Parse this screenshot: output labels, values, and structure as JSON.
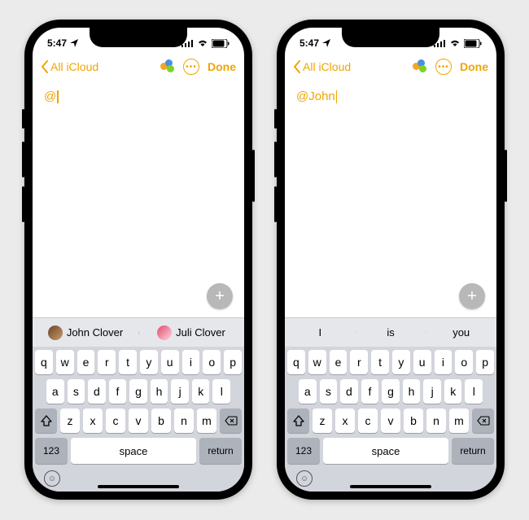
{
  "status": {
    "time": "5:47"
  },
  "nav": {
    "back": "All iCloud",
    "done": "Done"
  },
  "phones": [
    {
      "noteText": "@",
      "suggestions": [
        {
          "label": "John Clover",
          "avatar": "linear-gradient(135deg,#6b4226,#c69c6d)"
        },
        {
          "label": "Juli Clover",
          "avatar": "linear-gradient(135deg,#e3486b,#ffd6e0)"
        }
      ],
      "suggestionType": "contact"
    },
    {
      "noteText": "@John",
      "suggestions": [
        {
          "label": "I"
        },
        {
          "label": "is"
        },
        {
          "label": "you"
        }
      ],
      "suggestionType": "word"
    }
  ],
  "keyboard": {
    "rows": [
      [
        "q",
        "w",
        "e",
        "r",
        "t",
        "y",
        "u",
        "i",
        "o",
        "p"
      ],
      [
        "a",
        "s",
        "d",
        "f",
        "g",
        "h",
        "j",
        "k",
        "l"
      ],
      [
        "z",
        "x",
        "c",
        "v",
        "b",
        "n",
        "m"
      ]
    ],
    "mode": "123",
    "space": "space",
    "return": "return"
  }
}
